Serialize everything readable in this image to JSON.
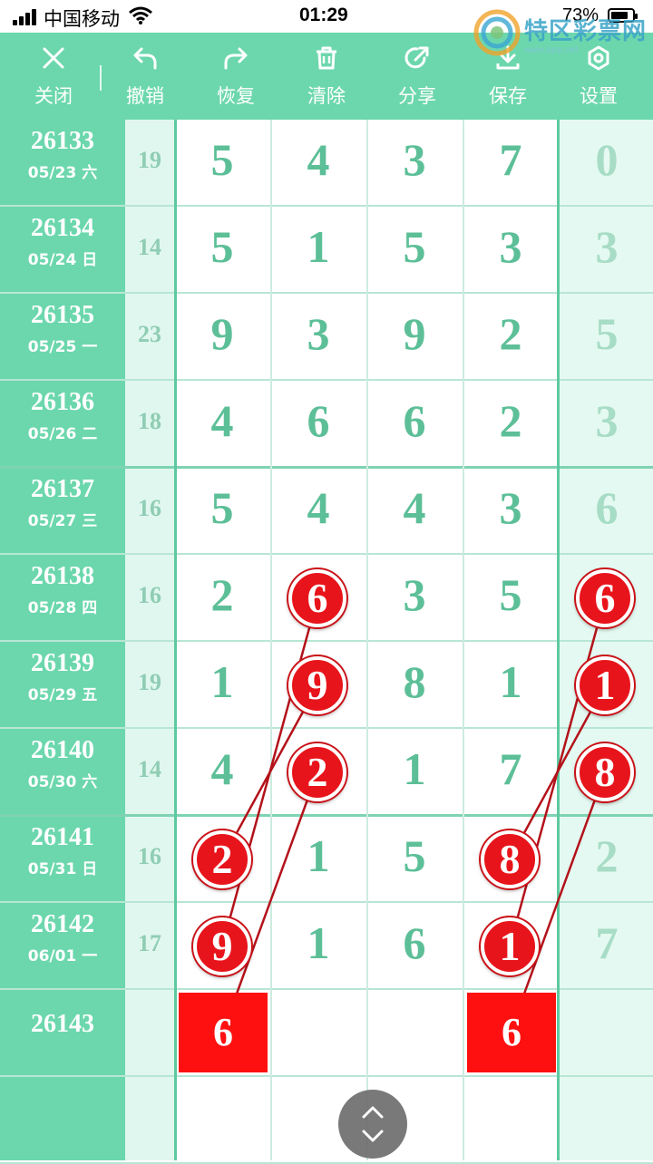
{
  "status_bar": {
    "carrier": "中国移动",
    "time": "01:29",
    "battery": "73%"
  },
  "toolbar": {
    "items": [
      {
        "label": "关闭",
        "icon": "close-icon"
      },
      {
        "label": "撤销",
        "icon": "undo-icon"
      },
      {
        "label": "恢复",
        "icon": "redo-icon"
      },
      {
        "label": "清除",
        "icon": "trash-icon"
      },
      {
        "label": "分享",
        "icon": "share-icon"
      },
      {
        "label": "保存",
        "icon": "download-icon"
      },
      {
        "label": "设置",
        "icon": "gear-icon"
      }
    ]
  },
  "watermark": {
    "name": "特区彩票网",
    "url": "www.tqcp.net"
  },
  "rows": [
    {
      "issue": "26133",
      "date": "05/23 六",
      "sum": "19",
      "d": [
        "5",
        "4",
        "3",
        "7"
      ],
      "last": "0"
    },
    {
      "issue": "26134",
      "date": "05/24 日",
      "sum": "14",
      "d": [
        "5",
        "1",
        "5",
        "3"
      ],
      "last": "3"
    },
    {
      "issue": "26135",
      "date": "05/25 一",
      "sum": "23",
      "d": [
        "9",
        "3",
        "9",
        "2"
      ],
      "last": "5"
    },
    {
      "issue": "26136",
      "date": "05/26 二",
      "sum": "18",
      "d": [
        "4",
        "6",
        "6",
        "2"
      ],
      "last": "3"
    },
    {
      "issue": "26137",
      "date": "05/27 三",
      "sum": "16",
      "d": [
        "5",
        "4",
        "4",
        "3"
      ],
      "last": "6"
    },
    {
      "issue": "26138",
      "date": "05/28 四",
      "sum": "16",
      "d": [
        "2",
        "6",
        "3",
        "5"
      ],
      "last": "6"
    },
    {
      "issue": "26139",
      "date": "05/29 五",
      "sum": "19",
      "d": [
        "1",
        "9",
        "8",
        "1"
      ],
      "last": "1"
    },
    {
      "issue": "26140",
      "date": "05/30 六",
      "sum": "14",
      "d": [
        "4",
        "2",
        "1",
        "7"
      ],
      "last": "8"
    },
    {
      "issue": "26141",
      "date": "05/31 日",
      "sum": "16",
      "d": [
        "2",
        "1",
        "5",
        "8"
      ],
      "last": "2"
    },
    {
      "issue": "26142",
      "date": "06/01 一",
      "sum": "17",
      "d": [
        "9",
        "1",
        "6",
        "1"
      ],
      "last": "7"
    },
    {
      "issue": "26143",
      "date": "",
      "sum": "",
      "d": [
        "",
        "",
        "",
        ""
      ],
      "last": ""
    }
  ],
  "highlights": [
    {
      "row": 5,
      "col": 1
    },
    {
      "row": 6,
      "col": 1
    },
    {
      "row": 7,
      "col": 1
    },
    {
      "row": 8,
      "col": 0
    },
    {
      "row": 9,
      "col": 0
    },
    {
      "row": 5,
      "col": 4
    },
    {
      "row": 6,
      "col": 4
    },
    {
      "row": 7,
      "col": 4
    },
    {
      "row": 8,
      "col": 3
    },
    {
      "row": 9,
      "col": 3
    }
  ],
  "predictions": [
    {
      "row": 10,
      "col": 0,
      "value": "6"
    },
    {
      "row": 10,
      "col": 3,
      "value": "6"
    }
  ],
  "trend_lines": [
    {
      "from": [
        5,
        1
      ],
      "to": [
        9,
        0
      ]
    },
    {
      "from": [
        6,
        1
      ],
      "to": [
        8,
        0
      ]
    },
    {
      "from": [
        7,
        1
      ],
      "to": [
        10,
        0
      ]
    },
    {
      "from": [
        5,
        4
      ],
      "to": [
        9,
        3
      ]
    },
    {
      "from": [
        6,
        4
      ],
      "to": [
        8,
        3
      ]
    },
    {
      "from": [
        7,
        4
      ],
      "to": [
        10,
        3
      ]
    }
  ],
  "colors": {
    "accent": "#6cd7ad",
    "ball": "#e8141b",
    "line": "#b3121a"
  }
}
